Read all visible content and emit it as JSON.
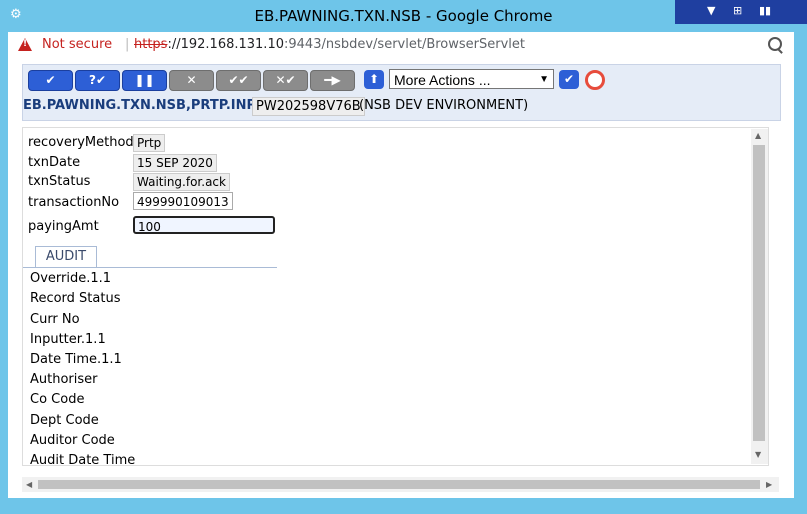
{
  "window": {
    "title": "EB.PAWNING.TXN.NSB - Google Chrome"
  },
  "address": {
    "security": "Not secure",
    "scheme": "https",
    "host": "://192.168.131.10",
    "rest": ":9443/nsbdev/servlet/BrowserServlet"
  },
  "toolbar": {
    "buttons": [
      {
        "symbol": "✔"
      },
      {
        "symbol": "?✔"
      },
      {
        "symbol": "❚❚"
      },
      {
        "symbol": "✕"
      },
      {
        "symbol": "✔✔"
      },
      {
        "symbol": "✕✔"
      },
      {
        "symbol": "━▶"
      }
    ],
    "actions_select": "More Actions ...",
    "app_id": "EB.PAWNING.TXN.NSB,PRTP.INPUT",
    "txn_id": "PW202598V76B",
    "environment": "(NSB DEV ENVIRONMENT)"
  },
  "form": {
    "fields": [
      {
        "label": "recoveryMethod",
        "value": "Prtp"
      },
      {
        "label": "txnDate",
        "value": "15 SEP 2020"
      },
      {
        "label": "txnStatus",
        "value": "Waiting.for.ack"
      },
      {
        "label": "transactionNo",
        "value": "499990109013"
      },
      {
        "label": "payingAmt",
        "value": "100"
      }
    ],
    "tab": "AUDIT",
    "audit": [
      "Override.1.1",
      "Record Status",
      "Curr No",
      "Inputter.1.1",
      "Date Time.1.1",
      "Authoriser",
      "Co Code",
      "Dept Code",
      "Auditor Code",
      "Audit Date Time"
    ]
  }
}
